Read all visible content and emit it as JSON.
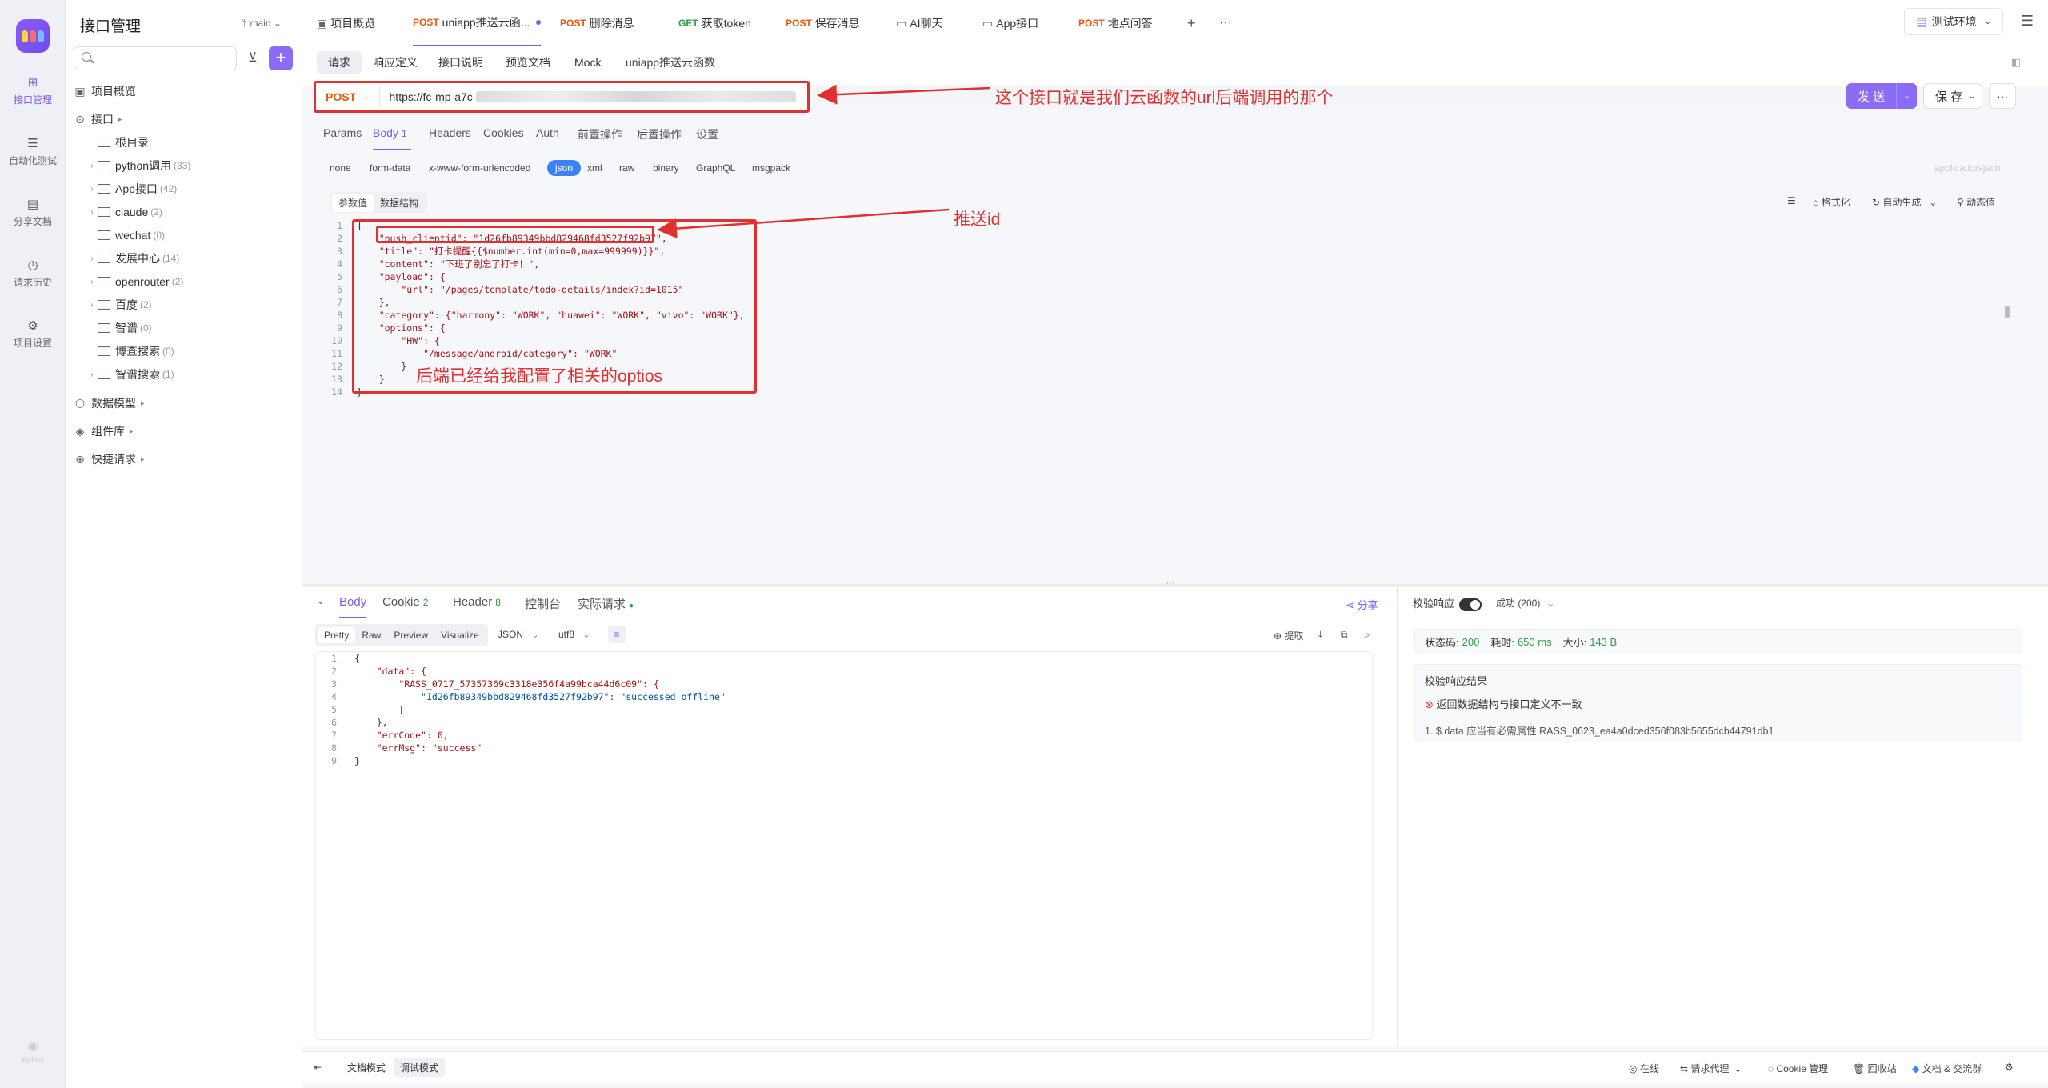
{
  "rail": {
    "items": [
      {
        "label": "接口管理",
        "icon": "api-icon"
      },
      {
        "label": "自动化测试",
        "icon": "test-icon"
      },
      {
        "label": "分享文档",
        "icon": "book-icon"
      },
      {
        "label": "请求历史",
        "icon": "history-icon"
      },
      {
        "label": "项目设置",
        "icon": "gear-icon"
      }
    ],
    "bottom_label": "Apifox"
  },
  "sidebar": {
    "title": "接口管理",
    "branch": "main",
    "search_placeholder": "",
    "overview": "项目概览",
    "api_root": "接口",
    "root_dir": "根目录",
    "folders": [
      {
        "name": "python调用",
        "count": "(33)"
      },
      {
        "name": "App接口",
        "count": "(42)"
      },
      {
        "name": "claude",
        "count": "(2)"
      },
      {
        "name": "wechat",
        "count": "(0)"
      },
      {
        "name": "发展中心",
        "count": "(14)"
      },
      {
        "name": "openrouter",
        "count": "(2)"
      },
      {
        "name": "百度",
        "count": "(2)"
      },
      {
        "name": "智谱",
        "count": "(0)"
      },
      {
        "name": "博查搜索",
        "count": "(0)"
      },
      {
        "name": "智谱搜索",
        "count": "(1)"
      }
    ],
    "data_model": "数据模型",
    "components": "组件库",
    "quick_request": "快捷请求"
  },
  "tabs": [
    {
      "method": "",
      "label": "项目概览"
    },
    {
      "method": "POST",
      "label": "uniapp推送云函..."
    },
    {
      "method": "POST",
      "label": "删除消息"
    },
    {
      "method": "GET",
      "label": "获取token"
    },
    {
      "method": "POST",
      "label": "保存消息"
    },
    {
      "method": "",
      "label": "AI聊天"
    },
    {
      "method": "",
      "label": "App接口"
    },
    {
      "method": "POST",
      "label": "地点问答"
    }
  ],
  "env": "测试环境",
  "subtabs": [
    "请求",
    "响应定义",
    "接口说明",
    "预览文档",
    "Mock"
  ],
  "api_name": "uniapp推送云函数",
  "request": {
    "method": "POST",
    "url_visible": "https://fc-mp-a7c",
    "send_label": "发 送",
    "save_label": "保 存"
  },
  "annotations": {
    "url": "这个接口就是我们云函数的url后端调用的那个",
    "push_id": "推送id",
    "options": "后端已经给我配置了相关的optios"
  },
  "req_tabs": [
    {
      "label": "Params",
      "badge": ""
    },
    {
      "label": "Body",
      "badge": "1"
    },
    {
      "label": "Headers",
      "badge": ""
    },
    {
      "label": "Cookies",
      "badge": ""
    },
    {
      "label": "Auth",
      "badge": ""
    },
    {
      "label": "前置操作",
      "badge": ""
    },
    {
      "label": "后置操作",
      "badge": ""
    },
    {
      "label": "设置",
      "badge": ""
    }
  ],
  "body_types": [
    "none",
    "form-data",
    "x-www-form-urlencoded",
    "json",
    "xml",
    "raw",
    "binary",
    "GraphQL",
    "msgpack"
  ],
  "content_type": "application/json",
  "body_modes": [
    "参数值",
    "数据结构"
  ],
  "body_tools": {
    "format": "格式化",
    "auto": "自动生成",
    "dynamic": "动态值"
  },
  "request_code": [
    "{",
    "    \"push_clientid\": \"1d26fb89349bbd829468fd3527f92b97\",",
    "    \"title\": \"打卡提醒{{$number.int(min=0,max=999999)}}\",",
    "    \"content\": \"下班了别忘了打卡！\",",
    "    \"payload\": {",
    "        \"url\": \"/pages/template/todo-details/index?id=1015\"",
    "    },",
    "    \"category\": {\"harmony\": \"WORK\", \"huawei\": \"WORK\", \"vivo\": \"WORK\"},",
    "    \"options\": {",
    "        \"HW\": {",
    "            \"/message/android/category\": \"WORK\"",
    "        }",
    "    }",
    "}"
  ],
  "resp_tabs": [
    {
      "label": "Body",
      "badge": ""
    },
    {
      "label": "Cookie",
      "badge": "2"
    },
    {
      "label": "Header",
      "badge": "8"
    },
    {
      "label": "控制台",
      "badge": ""
    },
    {
      "label": "实际请求",
      "badge": ""
    }
  ],
  "share_label": "分享",
  "resp_views": [
    "Pretty",
    "Raw",
    "Preview",
    "Visualize"
  ],
  "resp_format": "JSON",
  "resp_encoding": "utf8",
  "resp_tools": {
    "extract": "提取"
  },
  "response_code": [
    "{",
    "    \"data\": {",
    "        \"RASS_0717_57357369c3318e356f4a99bca44d6c09\": {",
    "            \"1d26fb89349bbd829468fd3527f92b97\": \"successed_offline\"",
    "        }",
    "    },",
    "    \"errCode\": 0,",
    "    \"errMsg\": \"success\"",
    "}"
  ],
  "check": {
    "toggle_label": "校验响应",
    "status_sel": "成功 (200)",
    "status_code_label": "状态码:",
    "status_code": "200",
    "time_label": "耗时:",
    "time": "650 ms",
    "size_label": "大小:",
    "size": "143 B",
    "result_title": "校验响应结果",
    "error": "返回数据结构与接口定义不一致",
    "detail": "1. $.data 应当有必需属性 RASS_0623_ea4a0dced356f083b5655dcb44791db1"
  },
  "footer": {
    "doc_mode": "文档模式",
    "debug_mode": "调试模式",
    "online": "在线",
    "proxy": "请求代理",
    "cookie": "Cookie 管理",
    "recycle": "回收站",
    "community": "文档 & 交流群"
  },
  "colors": {
    "accent": "#7b5cf5",
    "annotation": "#e03131",
    "post": "#e8590c",
    "get": "#2f9e44"
  }
}
